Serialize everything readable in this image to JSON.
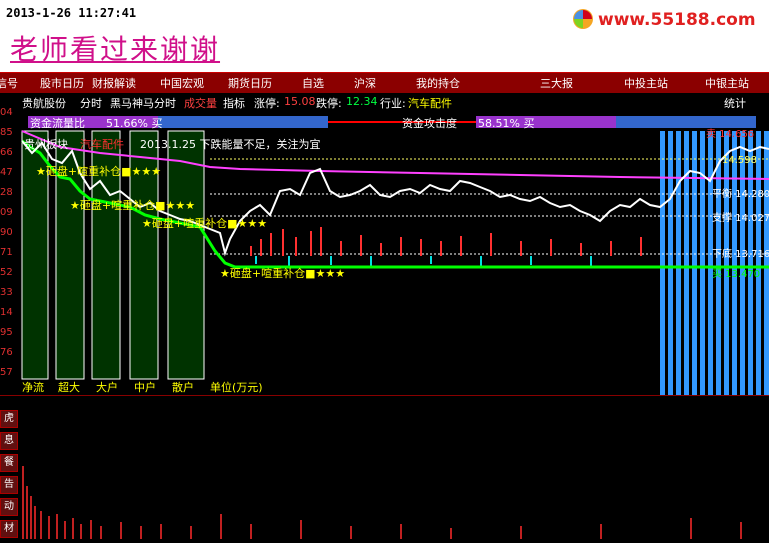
{
  "header": {
    "datetime": "2013-1-26 11:27:41",
    "promo_text": "老师看过来谢谢",
    "site_url": "www.55188.com"
  },
  "menu": {
    "items": [
      "信号",
      "股市日历",
      "财报解读",
      "中国宏观",
      "期货日历",
      "自选",
      "沪深",
      "我的持仓",
      "三大报",
      "中投主站",
      "中银主站"
    ]
  },
  "info": {
    "stock_name": "贵航股份",
    "mode": "分时",
    "indicator": "黑马神马分时",
    "chengjiaoliang": "成交量",
    "zhibiao": "指标",
    "limit_up_label": "涨停:",
    "limit_up_value": "15.08",
    "limit_down_label": "跌停:",
    "limit_down_value": "12.34",
    "industry_label": "行业:",
    "industry_value": "汽车配件",
    "stats": "统计"
  },
  "yaxis": {
    "ticks": [
      "04",
      "85",
      "66",
      "47",
      "28",
      "09",
      "90",
      "71",
      "52",
      "33",
      "14",
      "95",
      "76",
      "57"
    ]
  },
  "panel": {
    "fund_flow_label": "资金流量比",
    "fund_flow_value": "51.66% 买",
    "fund_attack_label": "资金攻击度",
    "fund_attack_value": "58.51% 买",
    "sector_label": "贵州板块",
    "industry_tag": "汽车配件",
    "note": "2013.1.25 下跌能量不足，关注为宜",
    "signals": [
      "★砸盘+喧重补仓■★★★",
      "★砸盘+喧重补仓■★★★",
      "★砸盘+喧重补仓■★★★",
      "★砸盘+喧重补仓■★★★"
    ],
    "bar_labels": [
      "净流",
      "超大",
      "大户",
      "中户",
      "散户"
    ],
    "unit": "单位(万元)",
    "right_labels": [
      "卖 14.656",
      "14.598",
      "平衡 14.280",
      "支撑 14.027",
      "下底 13.716",
      "买 13.470"
    ]
  },
  "side_tabs": [
    "虎",
    "息",
    "餐",
    "告",
    "动",
    "材"
  ],
  "colors": {
    "up": "#ff3030",
    "down": "#00e0e0",
    "price": "#ffffff",
    "avg": "#ff40ff",
    "signal_green": "#00ff00",
    "signal_yellow": "#ffff00",
    "flow_blue": "#3399ff"
  }
}
